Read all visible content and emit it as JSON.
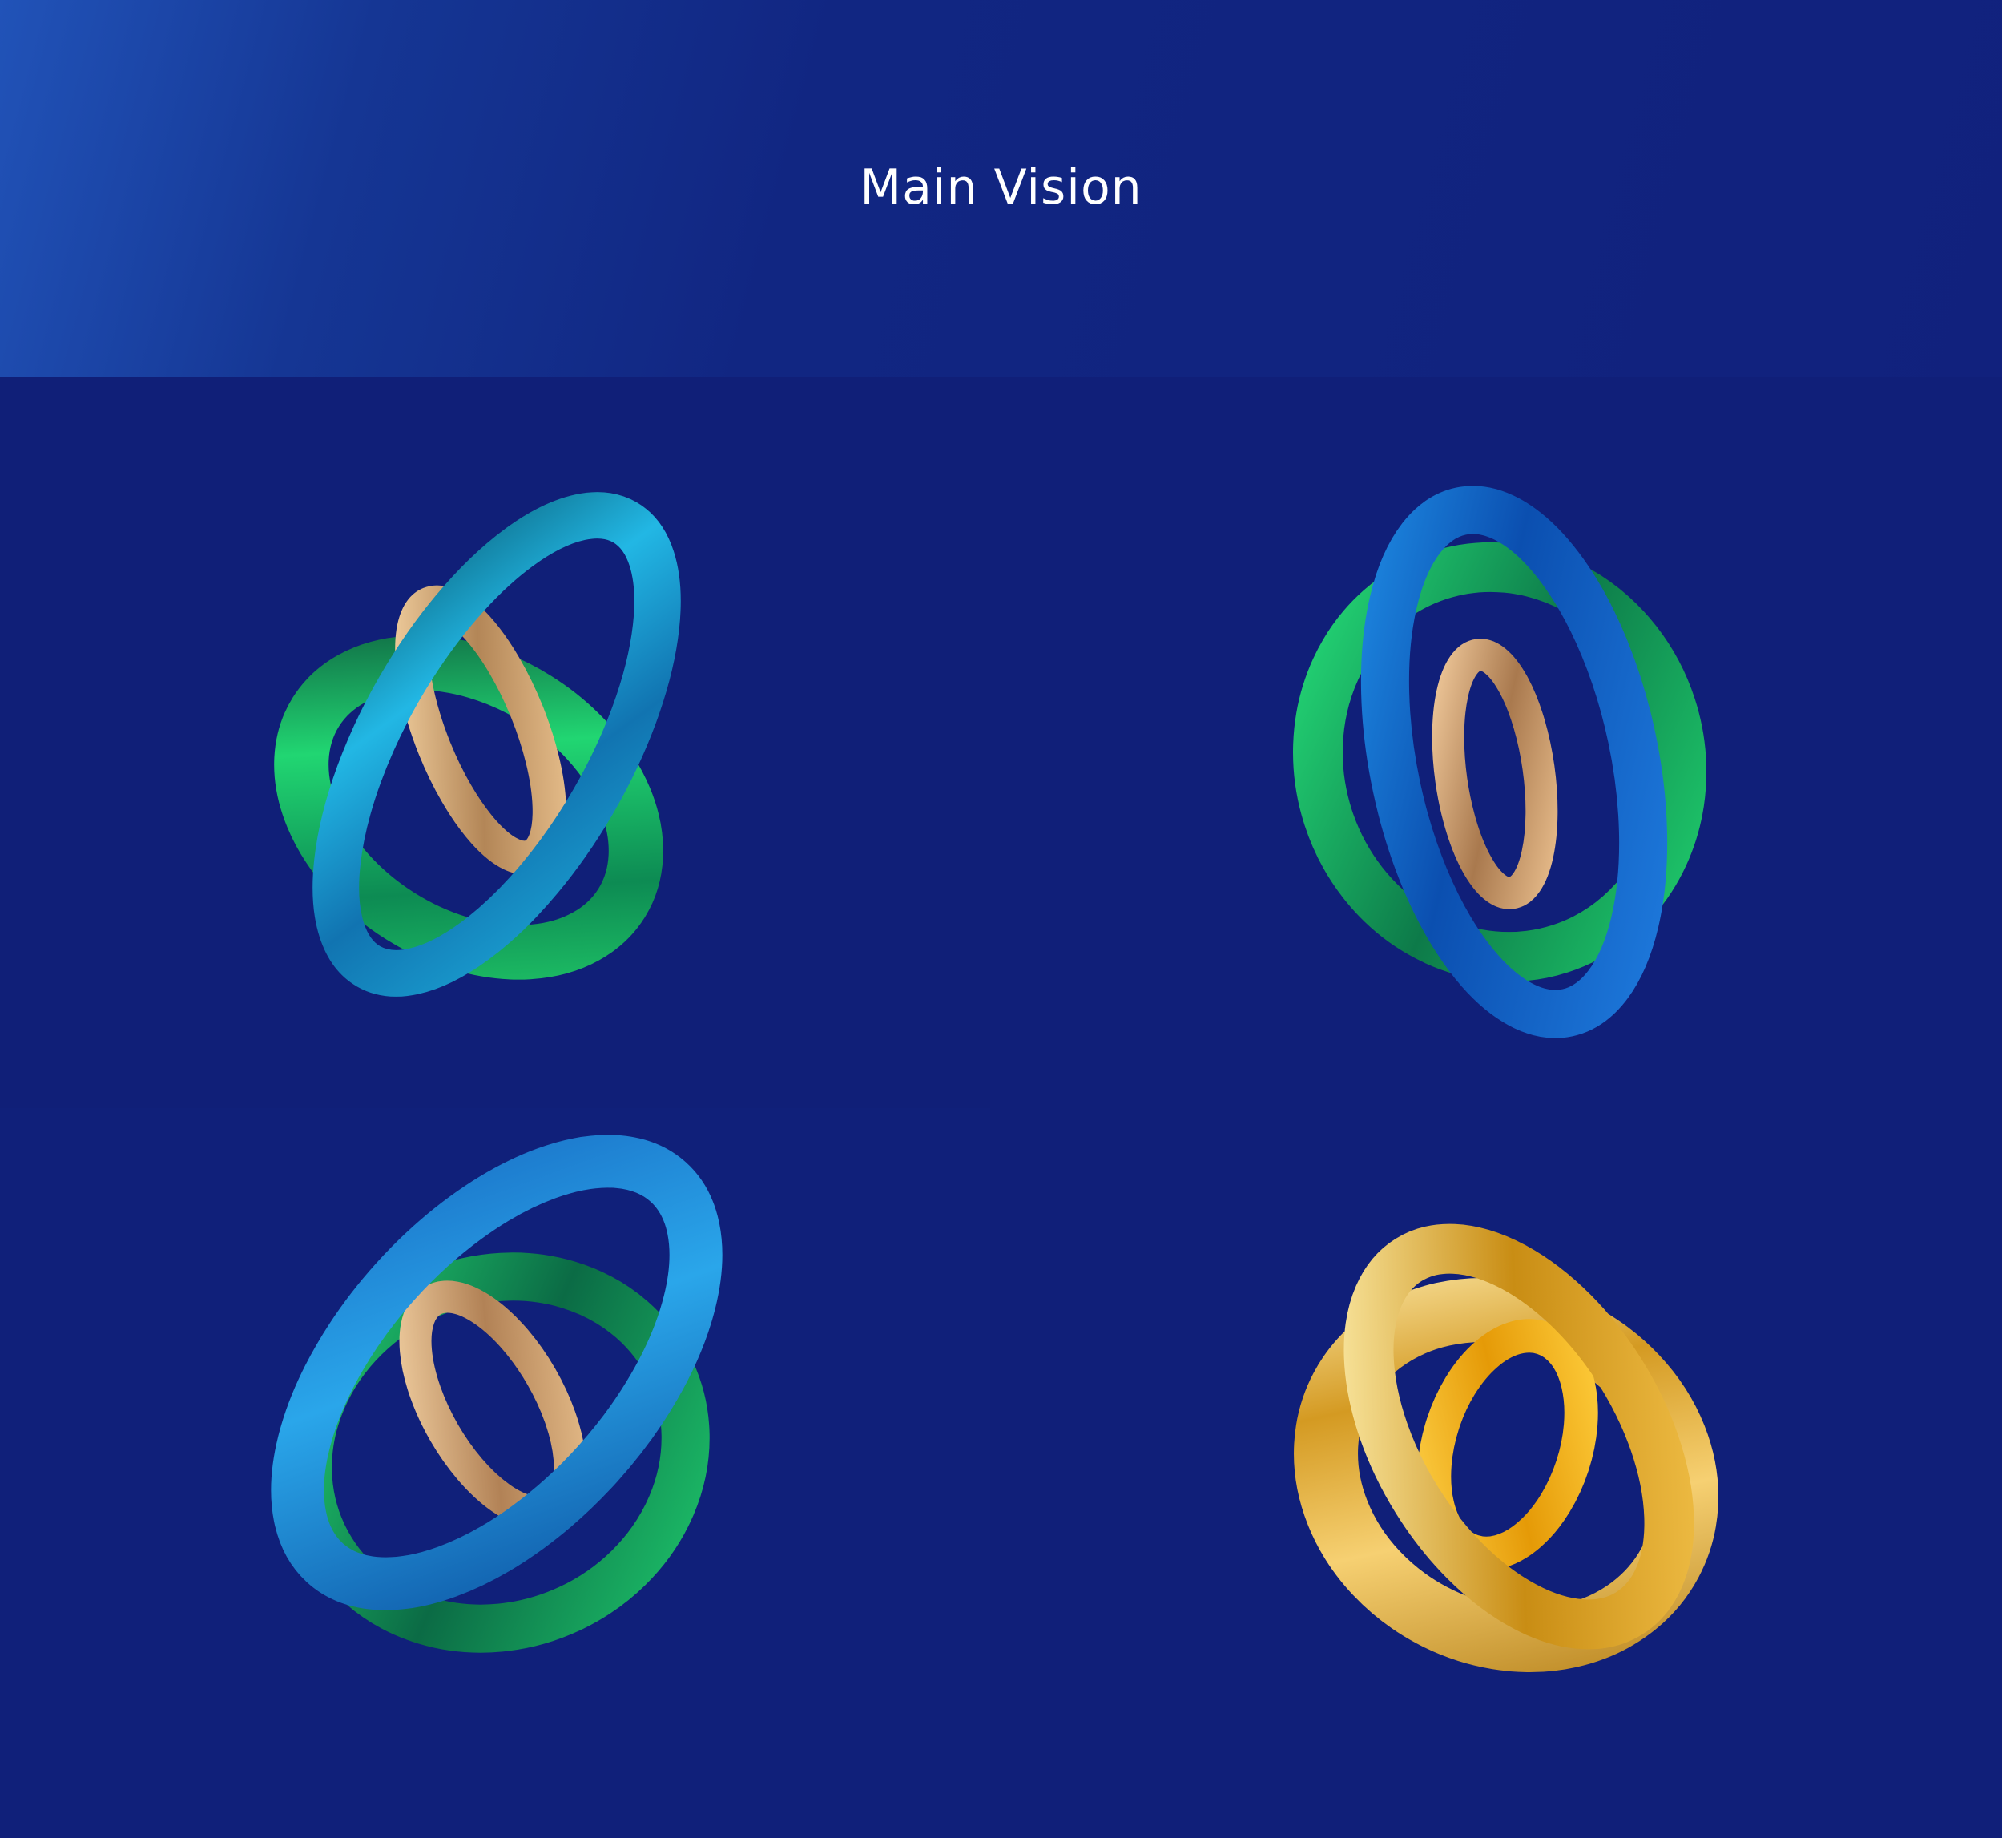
{
  "page": {
    "title": "Main Vision"
  },
  "colors": {
    "background": "#11217a",
    "header_gradient_start": "#2153b8",
    "header_gradient_end": "#11217d",
    "ribbon_green": "#19c86a",
    "ribbon_blue": "#1f8fe0",
    "ribbon_teal": "#1aa7c8",
    "ribbon_bronze": "#d9b07f",
    "ribbon_gold": "#f0b72a"
  },
  "renders": [
    {
      "name": "render-1",
      "palette": [
        "green",
        "teal-blue",
        "bronze"
      ]
    },
    {
      "name": "render-2",
      "palette": [
        "green",
        "blue",
        "bronze"
      ]
    },
    {
      "name": "render-3",
      "palette": [
        "green",
        "blue",
        "bronze"
      ]
    },
    {
      "name": "render-4",
      "palette": [
        "gold",
        "gold",
        "gold"
      ]
    }
  ]
}
